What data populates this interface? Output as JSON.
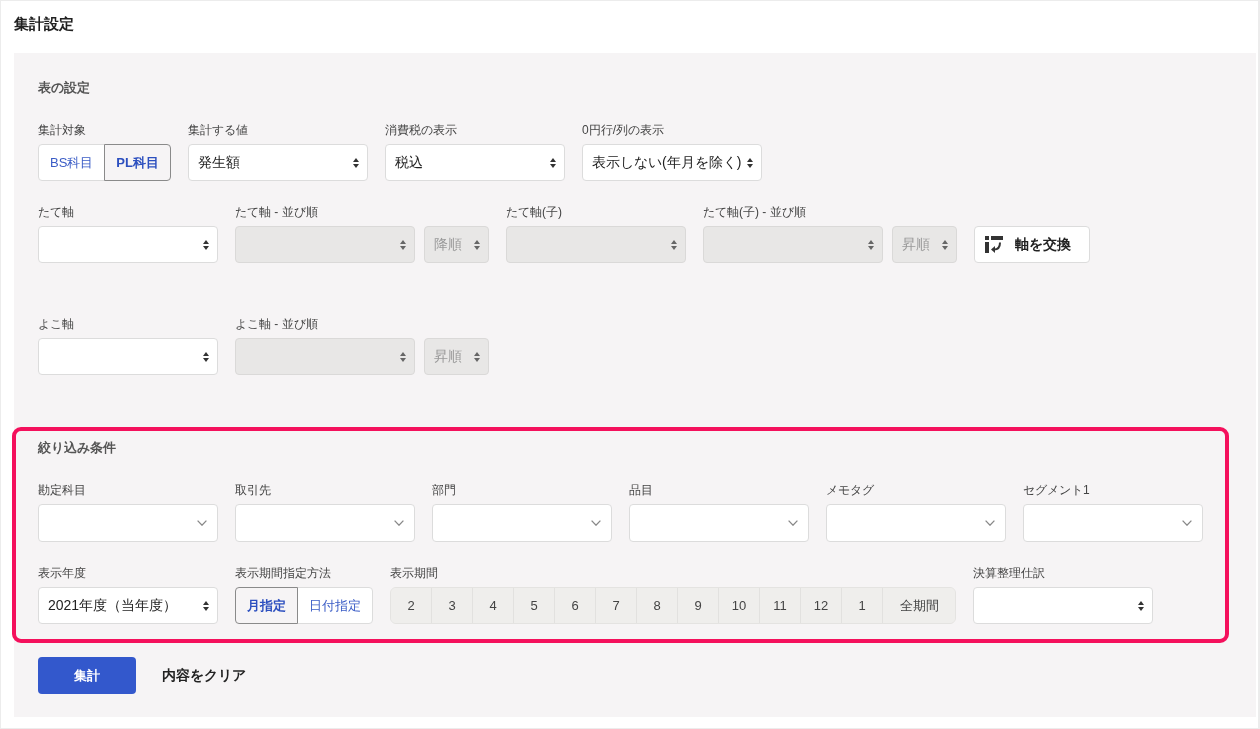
{
  "page": {
    "title": "集計設定"
  },
  "table_settings": {
    "heading": "表の設定",
    "rows": [
      {
        "fields": [
          {
            "kind": "segmented",
            "label": "集計対象",
            "options": [
              {
                "label": "BS科目",
                "selected": false
              },
              {
                "label": "PL科目",
                "selected": true
              }
            ]
          },
          {
            "kind": "select",
            "label": "集計する値",
            "value": "発生額",
            "disabled": false
          },
          {
            "kind": "select",
            "label": "消費税の表示",
            "value": "税込",
            "disabled": false
          },
          {
            "kind": "select",
            "label": "0円行/列の表示",
            "value": "表示しない(年月を除く)",
            "disabled": false
          }
        ]
      },
      {
        "fields": [
          {
            "kind": "select",
            "label": "たて軸",
            "disabled": false
          },
          {
            "kind": "sort",
            "label": "たて軸 - 並び順",
            "field": {
              "disabled": true
            },
            "order": {
              "value": "降順",
              "disabled": true
            }
          },
          {
            "kind": "select",
            "label": "たて軸(子)",
            "disabled": true
          },
          {
            "kind": "sort",
            "label": "たて軸(子) - 並び順",
            "field": {
              "disabled": true
            },
            "order": {
              "value": "昇順",
              "disabled": true
            }
          },
          {
            "kind": "button",
            "label": "軸を交換"
          }
        ]
      },
      {
        "fields": [
          {
            "kind": "select",
            "label": "よこ軸",
            "disabled": false
          },
          {
            "kind": "sort",
            "label": "よこ軸 - 並び順",
            "field": {
              "disabled": true
            },
            "order": {
              "value": "昇順",
              "disabled": true
            }
          }
        ]
      }
    ]
  },
  "filters": {
    "heading": "絞り込み条件",
    "highlighted": true,
    "rows": [
      {
        "fields": [
          {
            "kind": "combo",
            "label": "勘定科目"
          },
          {
            "kind": "combo",
            "label": "取引先"
          },
          {
            "kind": "combo",
            "label": "部門"
          },
          {
            "kind": "combo",
            "label": "品目"
          },
          {
            "kind": "combo",
            "label": "メモタグ"
          },
          {
            "kind": "combo",
            "label": "セグメント1"
          }
        ]
      },
      {
        "fields": [
          {
            "kind": "select",
            "label": "表示年度",
            "value": "2021年度（当年度）",
            "disabled": false
          },
          {
            "kind": "segmented",
            "label": "表示期間指定方法",
            "options": [
              {
                "label": "月指定",
                "selected": true
              },
              {
                "label": "日付指定",
                "selected": false
              }
            ]
          },
          {
            "kind": "periods",
            "label": "表示期間",
            "options": [
              {
                "label": "2",
                "selected": false
              },
              {
                "label": "3",
                "selected": false
              },
              {
                "label": "4",
                "selected": false
              },
              {
                "label": "5",
                "selected": false
              },
              {
                "label": "6",
                "selected": false
              },
              {
                "label": "7",
                "selected": false
              },
              {
                "label": "8",
                "selected": false
              },
              {
                "label": "9",
                "selected": false
              },
              {
                "label": "10",
                "selected": false
              },
              {
                "label": "11",
                "selected": false
              },
              {
                "label": "12",
                "selected": false
              },
              {
                "label": "1",
                "selected": false
              },
              {
                "label": "全期間",
                "selected": false
              }
            ]
          },
          {
            "kind": "select",
            "label": "決算整理仕訳",
            "disabled": false
          }
        ]
      }
    ]
  },
  "actions": [
    {
      "kind": "primary",
      "label": "集計"
    },
    {
      "kind": "link",
      "label": "内容をクリア"
    }
  ]
}
